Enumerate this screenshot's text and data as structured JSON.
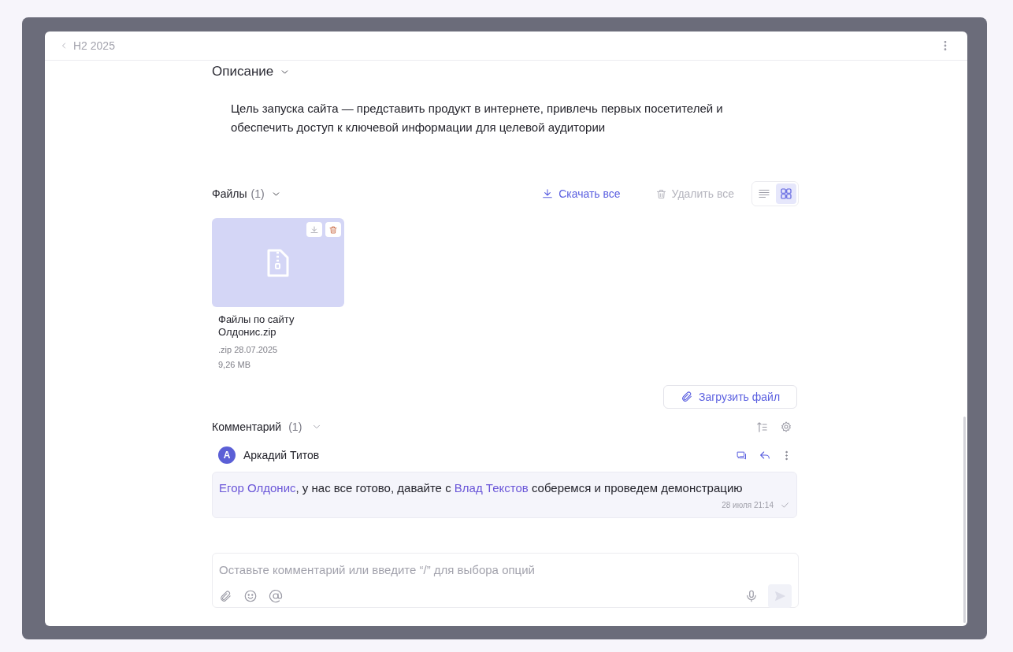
{
  "header": {
    "back_label": "H2 2025"
  },
  "description": {
    "title": "Описание",
    "text": "Цель запуска сайта — представить продукт в интернете, привлечь первых посетителей и обеспечить доступ к ключевой информации для целевой аудитории"
  },
  "files": {
    "title": "Файлы",
    "count": "(1)",
    "download_all": "Скачать все",
    "delete_all": {
      "label": "Удалить все",
      "disabled": true
    },
    "views": [
      {
        "kind": "list",
        "selected": false
      },
      {
        "kind": "grid",
        "selected": true
      }
    ],
    "items": [
      {
        "name": "Файлы по сайту Олдонис.zip",
        "meta": ".zip 28.07.2025",
        "size": "9,26 MB"
      }
    ],
    "upload": "Загрузить файл"
  },
  "comments": {
    "title": "Комментарий",
    "count": "(1)",
    "items": [
      {
        "avatar_letter": "A",
        "author": "Аркадий Титов",
        "parts": [
          {
            "kind": "mention",
            "text": "Егор Олдонис"
          },
          {
            "kind": "text",
            "text": ", у нас все готово, давайте с "
          },
          {
            "kind": "mention",
            "text": "Влад Текстов"
          },
          {
            "kind": "text",
            "text": " соберемся и проведем демонстрацию"
          }
        ],
        "time": "28 июля 21:14",
        "read": true
      }
    ]
  },
  "composer": {
    "placeholder": "Оставьте комментарий или введите “/” для выбора опций"
  }
}
